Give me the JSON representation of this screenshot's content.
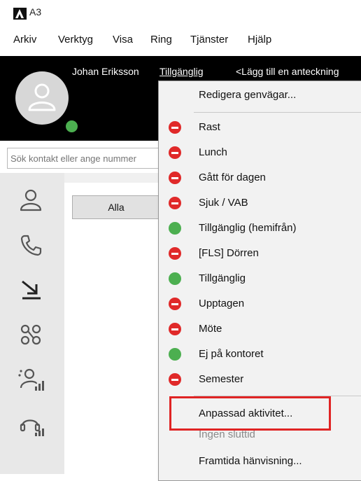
{
  "window": {
    "title": "A3"
  },
  "menubar": {
    "items": [
      {
        "label": "Arkiv"
      },
      {
        "label": "Verktyg"
      },
      {
        "label": "Visa"
      },
      {
        "label": "Ring"
      },
      {
        "label": "Tjänster"
      },
      {
        "label": "Hjälp"
      }
    ]
  },
  "profile": {
    "name": "Johan Eriksson",
    "status": "Tillgänglig",
    "note": "<Lägg till en anteckning",
    "presence_color": "#4caf50"
  },
  "search": {
    "placeholder": "Sök kontakt eller ange nummer"
  },
  "left_rail": {
    "icons": [
      "contacts-icon",
      "phone-icon",
      "call-forward-icon",
      "groups-icon",
      "queue-stats-icon",
      "headset-stats-icon"
    ]
  },
  "tabs": {
    "all_label": "Alla"
  },
  "status_menu": {
    "edit_shortcuts": "Redigera genvägar...",
    "statuses": [
      {
        "label": "Rast",
        "color": "red"
      },
      {
        "label": "Lunch",
        "color": "red"
      },
      {
        "label": "Gått för dagen",
        "color": "red"
      },
      {
        "label": "Sjuk / VAB",
        "color": "red"
      },
      {
        "label": "Tillgänglig (hemifrån)",
        "color": "green"
      },
      {
        "label": "[FLS] Dörren",
        "color": "red"
      },
      {
        "label": "Tillgänglig",
        "color": "green"
      },
      {
        "label": "Upptagen",
        "color": "red"
      },
      {
        "label": "Möte",
        "color": "red"
      },
      {
        "label": "Ej på kontoret",
        "color": "green"
      },
      {
        "label": "Semester",
        "color": "red"
      }
    ],
    "custom_activity": "Anpassad aktivitet...",
    "no_end_time": "Ingen sluttid",
    "future_redirect": "Framtida hänvisning..."
  },
  "colors": {
    "red": "#e02929",
    "green": "#4caf50",
    "highlight": "#e02424"
  }
}
